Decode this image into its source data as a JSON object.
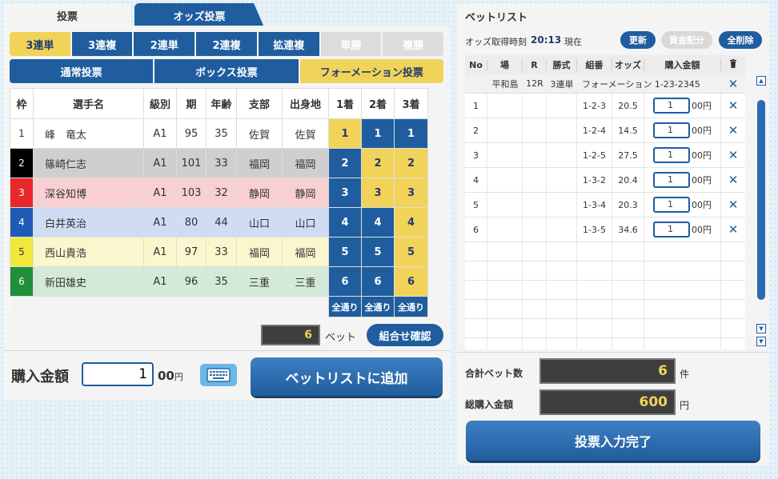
{
  "tabs": {
    "vote": "投票",
    "odds": "オッズ投票"
  },
  "bet_types": [
    "3連単",
    "3連複",
    "2連単",
    "2連複",
    "拡連複",
    "単勝",
    "複勝"
  ],
  "modes": [
    "通常投票",
    "ボックス投票",
    "フォーメーション投票"
  ],
  "table_headers": [
    "枠",
    "選手名",
    "級別",
    "期",
    "年齢",
    "支部",
    "出身地",
    "1着",
    "2着",
    "3着"
  ],
  "frame_colors": [
    "#ffffff",
    "#000000",
    "#e8282b",
    "#1f5bb5",
    "#f1e83c",
    "#1f8f3a"
  ],
  "row_colors": [
    "#ffffff",
    "#cfcfcf",
    "#f8cfd3",
    "#cfdcf2",
    "#faf7cf",
    "#d3ead8"
  ],
  "racers": [
    {
      "frame": "1",
      "name": "峰　竜太",
      "class": "A1",
      "term": "95",
      "age": "35",
      "branch": "佐賀",
      "home": "佐賀",
      "p1": "1",
      "p2": "1",
      "p3": "1"
    },
    {
      "frame": "2",
      "name": "篠崎仁志",
      "class": "A1",
      "term": "101",
      "age": "33",
      "branch": "福岡",
      "home": "福岡",
      "p1": "2",
      "p2": "2",
      "p3": "2"
    },
    {
      "frame": "3",
      "name": "深谷知博",
      "class": "A1",
      "term": "103",
      "age": "32",
      "branch": "静岡",
      "home": "静岡",
      "p1": "3",
      "p2": "3",
      "p3": "3"
    },
    {
      "frame": "4",
      "name": "白井英治",
      "class": "A1",
      "term": "80",
      "age": "44",
      "branch": "山口",
      "home": "山口",
      "p1": "4",
      "p2": "4",
      "p3": "4"
    },
    {
      "frame": "5",
      "name": "西山貴浩",
      "class": "A1",
      "term": "97",
      "age": "33",
      "branch": "福岡",
      "home": "福岡",
      "p1": "5",
      "p2": "5",
      "p3": "5"
    },
    {
      "frame": "6",
      "name": "新田雄史",
      "class": "A1",
      "term": "96",
      "age": "35",
      "branch": "三重",
      "home": "三重",
      "p1": "6",
      "p2": "6",
      "p3": "6"
    }
  ],
  "selections": {
    "first": [
      true,
      false,
      false,
      false,
      false,
      false
    ],
    "second": [
      false,
      true,
      true,
      false,
      false,
      false
    ],
    "third": [
      false,
      true,
      true,
      true,
      true,
      true
    ]
  },
  "all_label": "全通り",
  "bet_count": "6",
  "bet_unit": "ベット",
  "confirm_label": "組合せ確認",
  "amount_label": "購入金額",
  "amount_value": "1",
  "amount_unit": "00",
  "yen": "円",
  "add_label": "ベットリストに追加",
  "betlist": {
    "title": "ベットリスト",
    "time_label": "オッズ取得時刻",
    "time": "20:13",
    "time_suffix": "現在",
    "update": "更新",
    "alloc": "資金配分",
    "clear_all": "全削除",
    "headers": [
      "No",
      "場",
      "R",
      "勝式",
      "組番",
      "オッズ",
      "購入金額"
    ],
    "summary": {
      "venue": "平和島",
      "race": "12R",
      "type": "3連単",
      "combo": "フォーメーション",
      "code": "1-23-2345"
    },
    "bets": [
      {
        "no": "1",
        "combo": "1-2-3",
        "odds": "20.5",
        "amount": "1"
      },
      {
        "no": "2",
        "combo": "1-2-4",
        "odds": "14.5",
        "amount": "1"
      },
      {
        "no": "3",
        "combo": "1-2-5",
        "odds": "27.5",
        "amount": "1"
      },
      {
        "no": "4",
        "combo": "1-3-2",
        "odds": "20.4",
        "amount": "1"
      },
      {
        "no": "5",
        "combo": "1-3-4",
        "odds": "20.3",
        "amount": "1"
      },
      {
        "no": "6",
        "combo": "1-3-5",
        "odds": "34.6",
        "amount": "1"
      }
    ],
    "amount_unit": "00円",
    "total_bets_label": "合計ベット数",
    "total_bets": "6",
    "total_bets_unit": "件",
    "total_amount_label": "総購入金額",
    "total_amount": "600",
    "total_amount_unit": "円",
    "done_label": "投票入力完了"
  },
  "colors": {
    "accent_blue": "#1f5d9e",
    "select_yellow": "#f2d35a",
    "disabled": "#dcdcdc"
  }
}
